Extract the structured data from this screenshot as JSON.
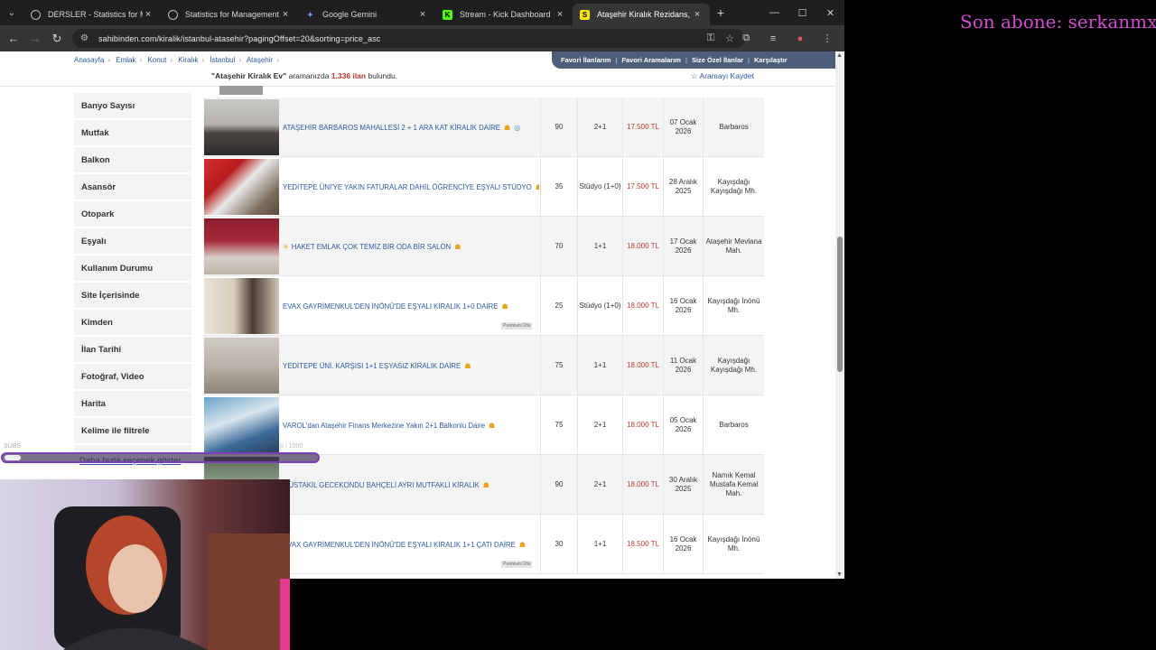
{
  "tabs": [
    {
      "title": "DERSLER - Statistics for Mana",
      "active": false
    },
    {
      "title": "Statistics for Management I",
      "active": false
    },
    {
      "title": "Google Gemini",
      "active": false
    },
    {
      "title": "Stream - Kick Dashboard",
      "active": false
    },
    {
      "title": "Ataşehir Kiralık Rezidans, Villa",
      "active": true
    }
  ],
  "address": {
    "url": "sahibinden.com/kiralik/istanbul-atasehir?pagingOffset=20&sorting=price_asc"
  },
  "breadcrumb": [
    "Anasayfa",
    "Emlak",
    "Konut",
    "Kiralık",
    "İstanbul",
    "Ataşehir"
  ],
  "top_menu": [
    "Favori İlanlarım",
    "Favori Aramalarım",
    "Size Özel İlanlar",
    "Karşılaştır"
  ],
  "result": {
    "query": "\"Ataşehir Kiralık Ev\"",
    "middle": "aramanızda",
    "count": "1.336 ilan",
    "suffix": "bulundu.",
    "save": "Aramayı Kaydet"
  },
  "sidebar": [
    "Banyo Sayısı",
    "Mutfak",
    "Balkon",
    "Asansör",
    "Otopark",
    "Eşyalı",
    "Kullanım Durumu",
    "Site İçerisinde",
    "Kimden",
    "İlan Tarihi",
    "Fotoğraf, Video",
    "Harita",
    "Kelime ile filtrele"
  ],
  "more_options": "Daha fazla seçenek göster",
  "listings": [
    {
      "title": "ATAŞEHİR BARBAROS MAHALLESİ 2 + 1 ARA KAT KİRALIK DAİRE",
      "m2": "90",
      "rooms": "2+1",
      "price": "17.500 TL",
      "date": "07 Ocak 2026",
      "location": "Barbaros",
      "premium": false
    },
    {
      "title": "YEDİTEPE ÜNİ'YE YAKIN FATURALAR DAHİL ÖĞRENCİYE EŞYALI STÜDYO",
      "m2": "35",
      "rooms": "Stüdyo (1+0)",
      "price": "17.500 TL",
      "date": "28 Aralık 2025",
      "location": "Kayışdağı Kayışdağı Mh.",
      "premium": false
    },
    {
      "title": "HAKET EMLAK ÇOK TEMİZ BİR ODA BİR SALON",
      "m2": "70",
      "rooms": "1+1",
      "price": "18.000 TL",
      "date": "17 Ocak 2026",
      "location": "Ataşehir Mevlana Mah.",
      "premium": false
    },
    {
      "title": "EVAX GAYRİMENKUL'DEN İNÖNÜ'DE EŞYALI KİRALIK 1+0 DAİRE",
      "m2": "25",
      "rooms": "Stüdyo (1+0)",
      "price": "18.000 TL",
      "date": "16 Ocak 2026",
      "location": "Kayışdağı İnönü Mh.",
      "premium": true
    },
    {
      "title": "YEDİTEPE ÜNİ. KARŞISI 1+1 EŞYASIZ KİRALIK DAİRE",
      "m2": "75",
      "rooms": "1+1",
      "price": "18.000 TL",
      "date": "11 Ocak 2026",
      "location": "Kayışdağı Kayışdağı Mh.",
      "premium": false
    },
    {
      "title": "VAROL'dan Ataşehir Finans Merkezine Yakın 2+1 Balkonlu Daire",
      "m2": "75",
      "rooms": "2+1",
      "price": "18.000 TL",
      "date": "05 Ocak 2026",
      "location": "Barbaros",
      "premium": false
    },
    {
      "title": "MÜSTAKİL GECEKONDU BAHÇELİ AYRI MUTFAKLI KİRALIK",
      "m2": "90",
      "rooms": "2+1",
      "price": "18.000 TL",
      "date": "30 Aralık 2025",
      "location": "Namık Kemal Mustafa Kemal Mah.",
      "premium": false
    },
    {
      "title": "EVAX GAYRİMENKUL'DEN İNÖNÜ'DE EŞYALI KİRALIK 1+1 ÇATI DAİRE",
      "m2": "30",
      "rooms": "1+1",
      "price": "18.500 TL",
      "date": "16 Ocak 2026",
      "location": "Kayışdağı İnönü Mh.",
      "premium": true
    }
  ],
  "premium_label": "Premium Ofis",
  "overlay": {
    "subscriber": "Son abone: serkanmx",
    "goal_label": "SUBS",
    "goal_count": "0 / 1000"
  },
  "colors": {
    "link": "#2c5aa0",
    "price": "#c0392b",
    "menu_bg": "#4e5d79",
    "overlay_text": "#d04cd0",
    "goal_border": "#7b3fb7"
  }
}
